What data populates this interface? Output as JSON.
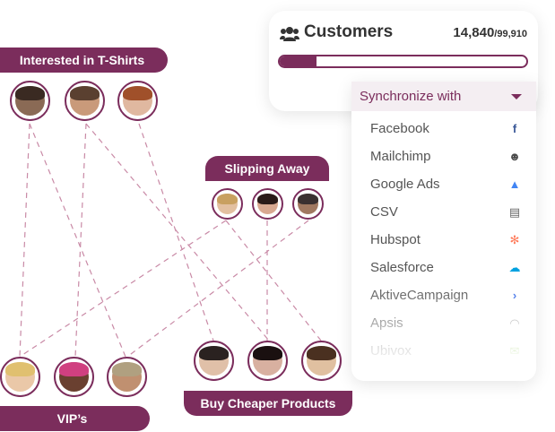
{
  "segments": {
    "tshirts": "Interested in T-Shirts",
    "slipping": "Slipping Away",
    "vips": "VIP’s",
    "cheaper": "Buy Cheaper Products"
  },
  "customers": {
    "title": "Customers",
    "count": "14,840",
    "total": "/99,910",
    "progress_fraction": 0.148,
    "accent": "#7b2d5c"
  },
  "sync": {
    "label": "Synchronize with",
    "items": [
      {
        "name": "Facebook",
        "icon": "facebook-icon",
        "glyph": "f",
        "color": "#3b5998"
      },
      {
        "name": "Mailchimp",
        "icon": "mailchimp-icon",
        "glyph": "☻",
        "color": "#4a4a4a"
      },
      {
        "name": "Google Ads",
        "icon": "google-ads-icon",
        "glyph": "▲",
        "color": "#4285f4"
      },
      {
        "name": "CSV",
        "icon": "csv-icon",
        "glyph": "▤",
        "color": "#666666"
      },
      {
        "name": "Hubspot",
        "icon": "hubspot-icon",
        "glyph": "✻",
        "color": "#ff7a59"
      },
      {
        "name": "Salesforce",
        "icon": "salesforce-icon",
        "glyph": "☁",
        "color": "#00a1e0"
      },
      {
        "name": "AktiveCampaign",
        "icon": "activecampaign-icon",
        "glyph": "›",
        "color": "#356ae6"
      },
      {
        "name": "Apsis",
        "icon": "apsis-icon",
        "glyph": "◠",
        "color": "#999999"
      },
      {
        "name": "Ubivox",
        "icon": "ubivox-icon",
        "glyph": "✉",
        "color": "#8bc34a"
      }
    ]
  }
}
